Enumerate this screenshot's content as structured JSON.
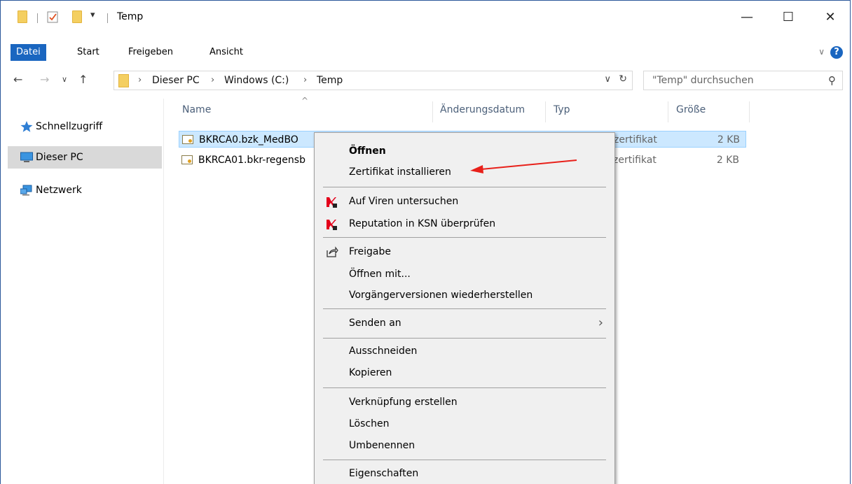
{
  "window": {
    "title": "Temp",
    "controls": {
      "minimize": "—",
      "maximize": "☐",
      "close": "✕"
    }
  },
  "ribbon": {
    "tabs": [
      "Datei",
      "Start",
      "Freigeben",
      "Ansicht"
    ],
    "active_tab": "Datei",
    "help": "?"
  },
  "address": {
    "crumbs": [
      "Dieser PC",
      "Windows (C:)",
      "Temp"
    ],
    "search_placeholder": "\"Temp\" durchsuchen"
  },
  "nav_pane": {
    "items": [
      {
        "label": "Schnellzugriff",
        "icon": "star-icon"
      },
      {
        "label": "Dieser PC",
        "icon": "computer-icon",
        "selected": true
      },
      {
        "label": "Netzwerk",
        "icon": "network-icon"
      }
    ]
  },
  "file_list": {
    "columns": [
      "Name",
      "Änderungsdatum",
      "Typ",
      "Größe"
    ],
    "rows": [
      {
        "name": "BKRCA0.bzk_MedBO",
        "type": "zertifikat",
        "size": "2 KB",
        "selected": true
      },
      {
        "name": "BKRCA01.bkr-regensb",
        "type": "zertifikat",
        "size": "2 KB",
        "selected": false
      }
    ]
  },
  "context_menu": {
    "groups": [
      [
        {
          "label": "Öffnen",
          "bold": true
        },
        {
          "label": "Zertifikat installieren"
        }
      ],
      [
        {
          "label": "Auf Viren untersuchen",
          "icon": "kaspersky-icon"
        },
        {
          "label": "Reputation in KSN überprüfen",
          "icon": "kaspersky-icon"
        }
      ],
      [
        {
          "label": "Freigabe",
          "icon": "share-icon"
        },
        {
          "label": "Öffnen mit..."
        },
        {
          "label": "Vorgängerversionen wiederherstellen"
        }
      ],
      [
        {
          "label": "Senden an",
          "submenu": true
        }
      ],
      [
        {
          "label": "Ausschneiden"
        },
        {
          "label": "Kopieren"
        }
      ],
      [
        {
          "label": "Verknüpfung erstellen"
        },
        {
          "label": "Löschen"
        },
        {
          "label": "Umbenennen"
        }
      ],
      [
        {
          "label": "Eigenschaften"
        }
      ]
    ]
  },
  "annotation": {
    "arrow_color": "#e8201a"
  }
}
